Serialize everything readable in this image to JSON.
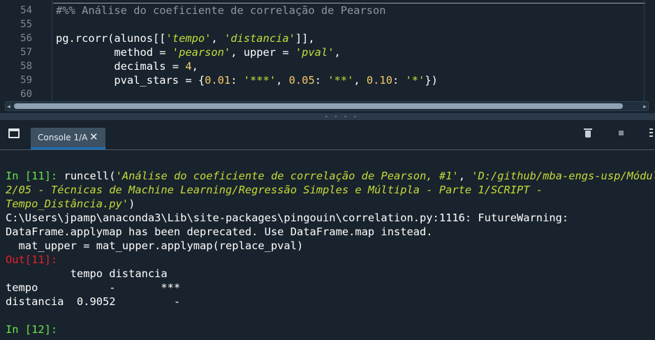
{
  "editor": {
    "line_numbers": [
      "54",
      "55",
      "56",
      "57",
      "58",
      "59",
      "60"
    ],
    "lines": [
      [
        {
          "t": "#%% Análise do coeficiente de correlação de Pearson",
          "c": "cmt"
        }
      ],
      [],
      [
        {
          "t": "pg.rcorr(alunos[[",
          "c": ""
        },
        {
          "t": "'tempo'",
          "c": "str"
        },
        {
          "t": ", ",
          "c": ""
        },
        {
          "t": "'distancia'",
          "c": "str"
        },
        {
          "t": "]],",
          "c": ""
        }
      ],
      [
        {
          "t": "         method = ",
          "c": ""
        },
        {
          "t": "'pearson'",
          "c": "str"
        },
        {
          "t": ", upper = ",
          "c": ""
        },
        {
          "t": "'pval'",
          "c": "str"
        },
        {
          "t": ",",
          "c": ""
        }
      ],
      [
        {
          "t": "         decimals = ",
          "c": ""
        },
        {
          "t": "4",
          "c": "num"
        },
        {
          "t": ",",
          "c": ""
        }
      ],
      [
        {
          "t": "         pval_stars = {",
          "c": ""
        },
        {
          "t": "0.01",
          "c": "num"
        },
        {
          "t": ": ",
          "c": ""
        },
        {
          "t": "'***'",
          "c": "str"
        },
        {
          "t": ", ",
          "c": ""
        },
        {
          "t": "0.05",
          "c": "num"
        },
        {
          "t": ": ",
          "c": ""
        },
        {
          "t": "'**'",
          "c": "str"
        },
        {
          "t": ", ",
          "c": ""
        },
        {
          "t": "0.10",
          "c": "num"
        },
        {
          "t": ": ",
          "c": ""
        },
        {
          "t": "'*'",
          "c": "str"
        },
        {
          "t": "})",
          "c": ""
        }
      ],
      []
    ]
  },
  "console_pane": {
    "tab_label": "Console 1/A",
    "icons": [
      "pane-window-icon",
      "tab-close-icon",
      "trash-icon",
      "stop-icon",
      "menu-icon"
    ]
  },
  "console": {
    "lines": [
      [
        {
          "t": "In [",
          "c": "prompt-in"
        },
        {
          "t": "11",
          "c": "prompt-in"
        },
        {
          "t": "]: ",
          "c": "prompt-in"
        },
        {
          "t": "runcell(",
          "c": ""
        },
        {
          "t": "'Análise do coeficiente de correlação de Pearson, #1'",
          "c": "cstr"
        },
        {
          "t": ", ",
          "c": ""
        },
        {
          "t": "'D:/github/mba-engs-usp/Módulo",
          "c": "cstr"
        }
      ],
      [
        {
          "t": "2/05 - Técnicas de Machine Learning/Regressão Simples e Múltipla - Parte 1/SCRIPT -",
          "c": "cstr"
        }
      ],
      [
        {
          "t": "Tempo_Distância.py'",
          "c": "cstr"
        },
        {
          "t": ")",
          "c": ""
        }
      ],
      [
        {
          "t": "C:\\Users\\jpamp\\anaconda3\\Lib\\site-packages\\pingouin\\correlation.py:1116: FutureWarning:",
          "c": ""
        }
      ],
      [
        {
          "t": "DataFrame.applymap has been deprecated. Use DataFrame.map instead.",
          "c": ""
        }
      ],
      [
        {
          "t": "  mat_upper = mat_upper.applymap(replace_pval)",
          "c": ""
        }
      ],
      [
        {
          "t": "Out[",
          "c": "prompt-out"
        },
        {
          "t": "11",
          "c": "prompt-out"
        },
        {
          "t": "]:",
          "c": "prompt-out"
        }
      ],
      [
        {
          "t": "          tempo distancia",
          "c": ""
        }
      ],
      [
        {
          "t": "tempo           -       ***",
          "c": ""
        }
      ],
      [
        {
          "t": "distancia  0.9052         -",
          "c": ""
        }
      ],
      [],
      [
        {
          "t": "In [",
          "c": "prompt-in"
        },
        {
          "t": "12",
          "c": "prompt-in"
        },
        {
          "t": "]:",
          "c": "prompt-in"
        }
      ]
    ]
  }
}
